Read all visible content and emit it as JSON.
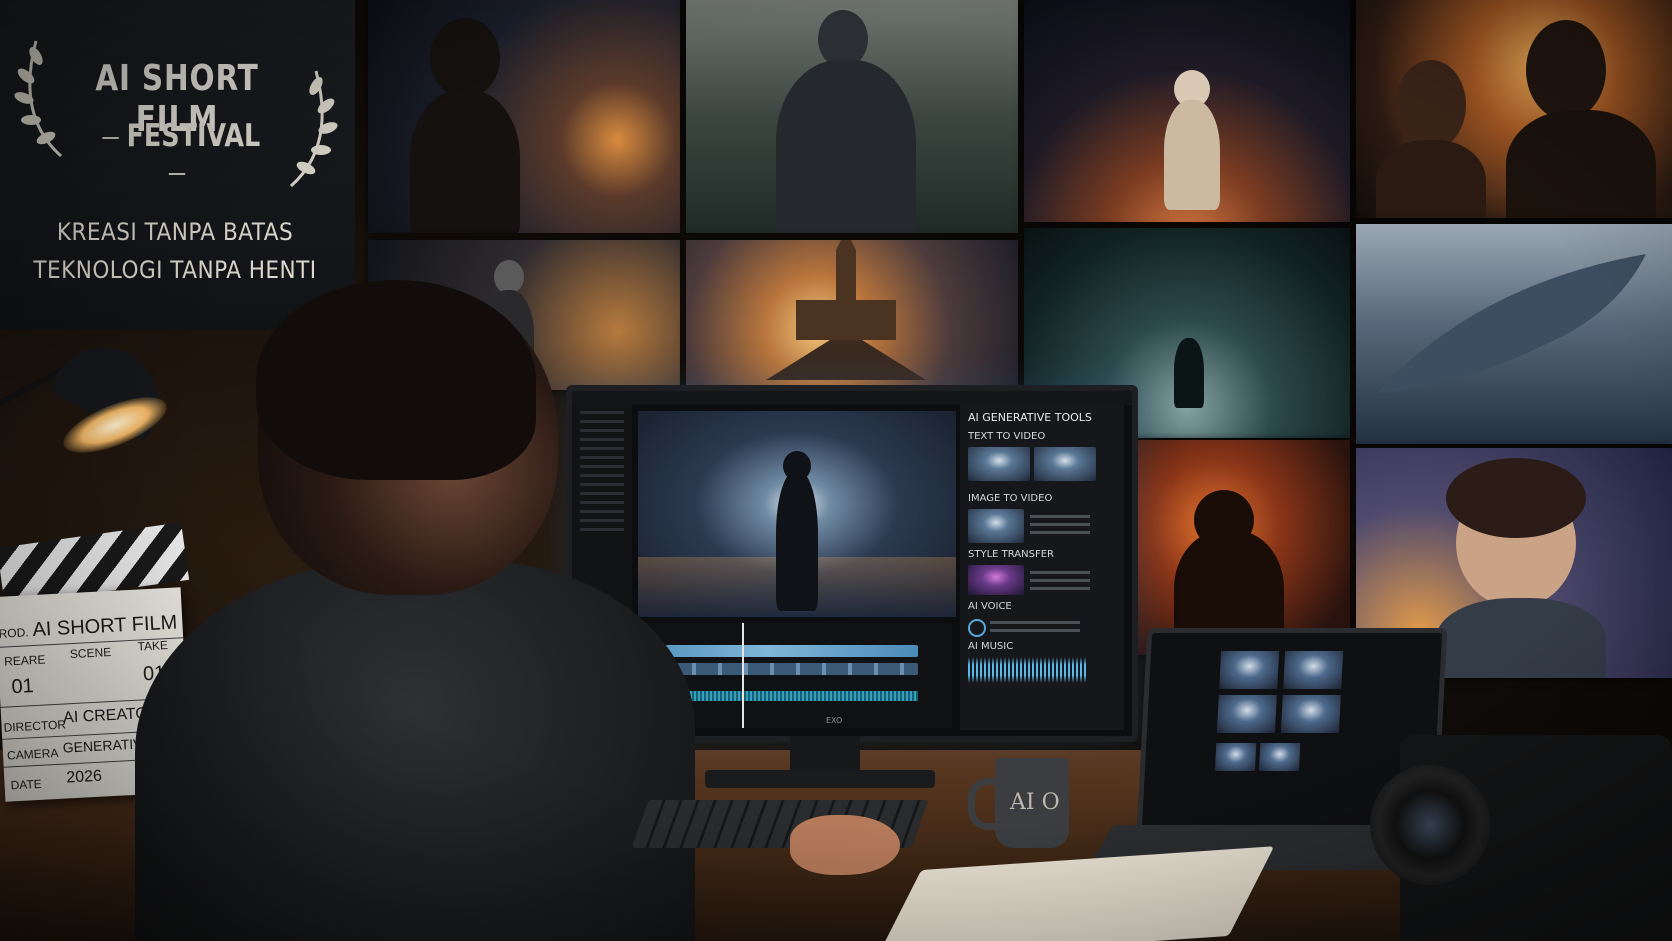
{
  "banner": {
    "title": "AI SHORT FILM",
    "subtitle": "FESTIVAL",
    "tagline_1": "KREASI TANPA BATAS",
    "tagline_2": "TEKNOLOGI TANPA HENTI"
  },
  "clapperboard": {
    "prod_label": "ROD.",
    "prod_value": "AI SHORT FILM",
    "reel_label": "REARE",
    "reel_value": "01",
    "scene_label": "SCENE",
    "take_label": "TAKE",
    "take_value": "01",
    "director_label": "DIRECTOR",
    "director_value": "AI CREATOR",
    "camera_label": "CAMERA",
    "camera_value": "GENERATIVE AI",
    "date_label": "DATE",
    "date_value": "2026"
  },
  "editor": {
    "panel_title": "AI GENERATIVE TOOLS",
    "tools": [
      {
        "label": "TEXT TO VIDEO"
      },
      {
        "label": "IMAGE TO VIDEO"
      },
      {
        "label": "STYLE TRANSFER"
      },
      {
        "label": "AI VOICE"
      },
      {
        "label": "AI MUSIC"
      }
    ]
  },
  "monitor": {
    "brand": "EXO"
  },
  "mug": {
    "label": "AI O"
  }
}
